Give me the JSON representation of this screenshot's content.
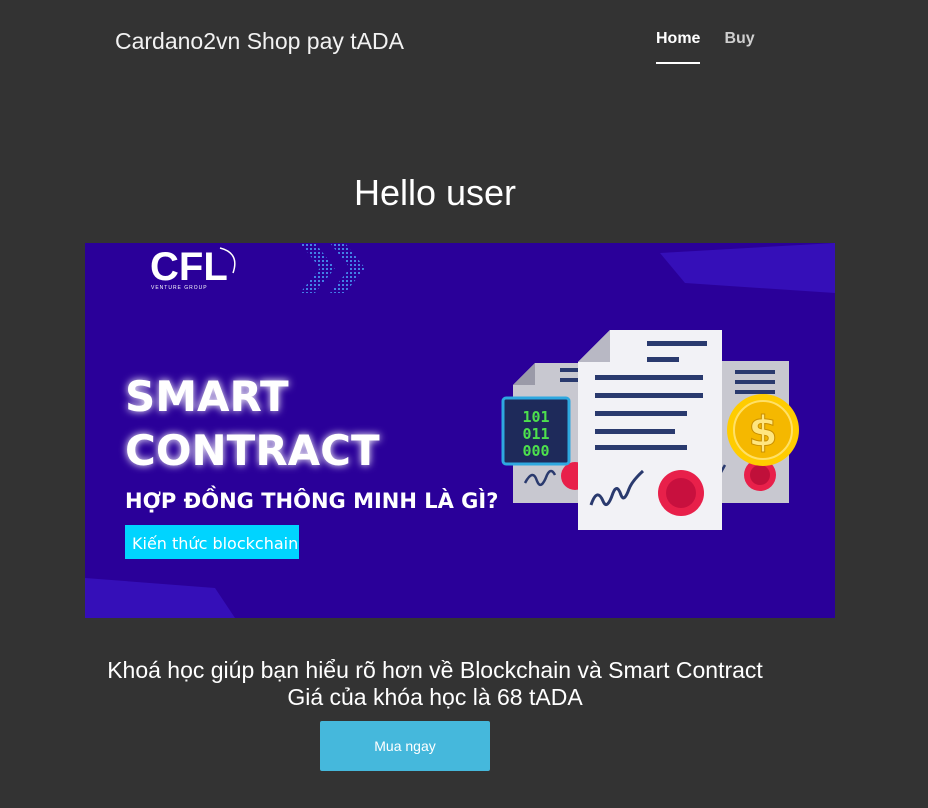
{
  "header": {
    "brand": "Cardano2vn Shop pay tADA",
    "nav": [
      {
        "label": "Home",
        "active": true
      },
      {
        "label": "Buy",
        "active": false
      }
    ]
  },
  "main": {
    "greeting": "Hello user",
    "banner": {
      "logo_text": "CFL",
      "logo_subtext": "VENTURE GROUP",
      "headline_line1": "SMART",
      "headline_line2": "CONTRACT",
      "subheadline": "HỢP ĐỒNG THÔNG MINH LÀ GÌ?",
      "tag": "Kiến thức blockchain",
      "binary_line1": "101",
      "binary_line2": "011",
      "binary_line3": "000",
      "coin_symbol": "$",
      "colors": {
        "background": "#2a0099",
        "tag": "#00d4ff",
        "coin": "#ffcc00",
        "seal": "#e8204a"
      }
    },
    "description_line1": "Khoá học giúp bạn hiểu rõ hơn về Blockchain và Smart Contract",
    "description_line2": "Giá của khóa học là 68 tADA",
    "buy_button": "Mua ngay"
  }
}
